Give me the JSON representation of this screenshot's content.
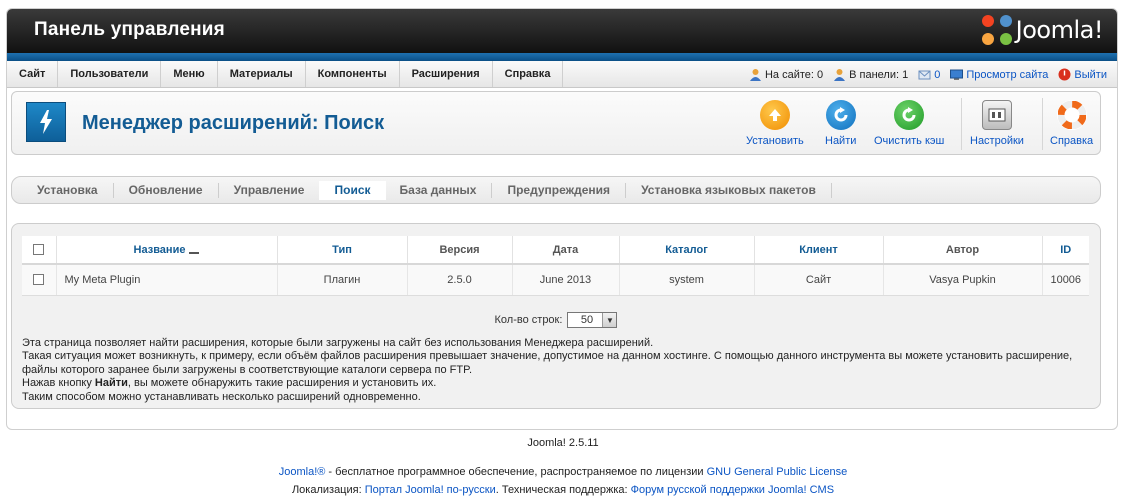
{
  "header": {
    "title": "Панель управления",
    "logo_text": "Joomla!"
  },
  "menu": {
    "items": [
      "Сайт",
      "Пользователи",
      "Меню",
      "Материалы",
      "Компоненты",
      "Расширения",
      "Справка"
    ]
  },
  "status": {
    "on_site": "На сайте: 0",
    "in_panel": "В панели: 1",
    "messages": "0",
    "view_site": "Просмотр сайта",
    "logout": "Выйти"
  },
  "toolbar": {
    "title": "Менеджер расширений: Поиск",
    "install": "Установить",
    "find": "Найти",
    "clear_cache": "Очистить кэш",
    "settings": "Настройки",
    "help": "Справка"
  },
  "tabs": [
    "Установка",
    "Обновление",
    "Управление",
    "Поиск",
    "База данных",
    "Предупреждения",
    "Установка языковых пакетов"
  ],
  "table": {
    "headers": {
      "name": "Название",
      "type": "Тип",
      "version": "Версия",
      "date": "Дата",
      "folder": "Каталог",
      "client": "Клиент",
      "author": "Автор",
      "id": "ID"
    },
    "rows": [
      {
        "name": "My Meta Plugin",
        "type": "Плагин",
        "version": "2.5.0",
        "date": "June 2013",
        "folder": "system",
        "client": "Сайт",
        "author": "Vasya Pupkin",
        "id": "10006"
      }
    ]
  },
  "pagination": {
    "label": "Кол-во строк:",
    "value": "50"
  },
  "info": {
    "line1": "Эта страница позволяет найти расширения, которые были загружены на сайт без использования Менеджера расширений.",
    "line2": "Такая ситуация может возникнуть, к примеру, если объём файлов расширения превышает значение, допустимое на данном хостинге. С помощью данного инструмента вы можете установить расширение, файлы которого заранее были загружены в соответствующие каталоги сервера по FTP.",
    "line3_pre": "Нажав кнопку ",
    "line3_bold": "Найти",
    "line3_post": ", вы можете обнаружить такие расширения и установить их.",
    "line4": "Таким способом можно устанавливать несколько расширений одновременно."
  },
  "footer": {
    "version": "Joomla! 2.5.11",
    "line1_link1": "Joomla!®",
    "line1_text": " - бесплатное программное обеспечение, распространяемое по лицензии ",
    "line1_link2": "GNU General Public License",
    "line2_text1": "Локализация: ",
    "line2_link1": "Портал Joomla! по-русски",
    "line2_text2": ". Техническая поддержка: ",
    "line2_link2": "Форум русской поддержки Joomla! CMS"
  },
  "colors": {
    "accent": "#135c94",
    "link": "#0b55c4",
    "header_bg": "#1a1a1a",
    "blue_bar": "#1d70b0"
  }
}
